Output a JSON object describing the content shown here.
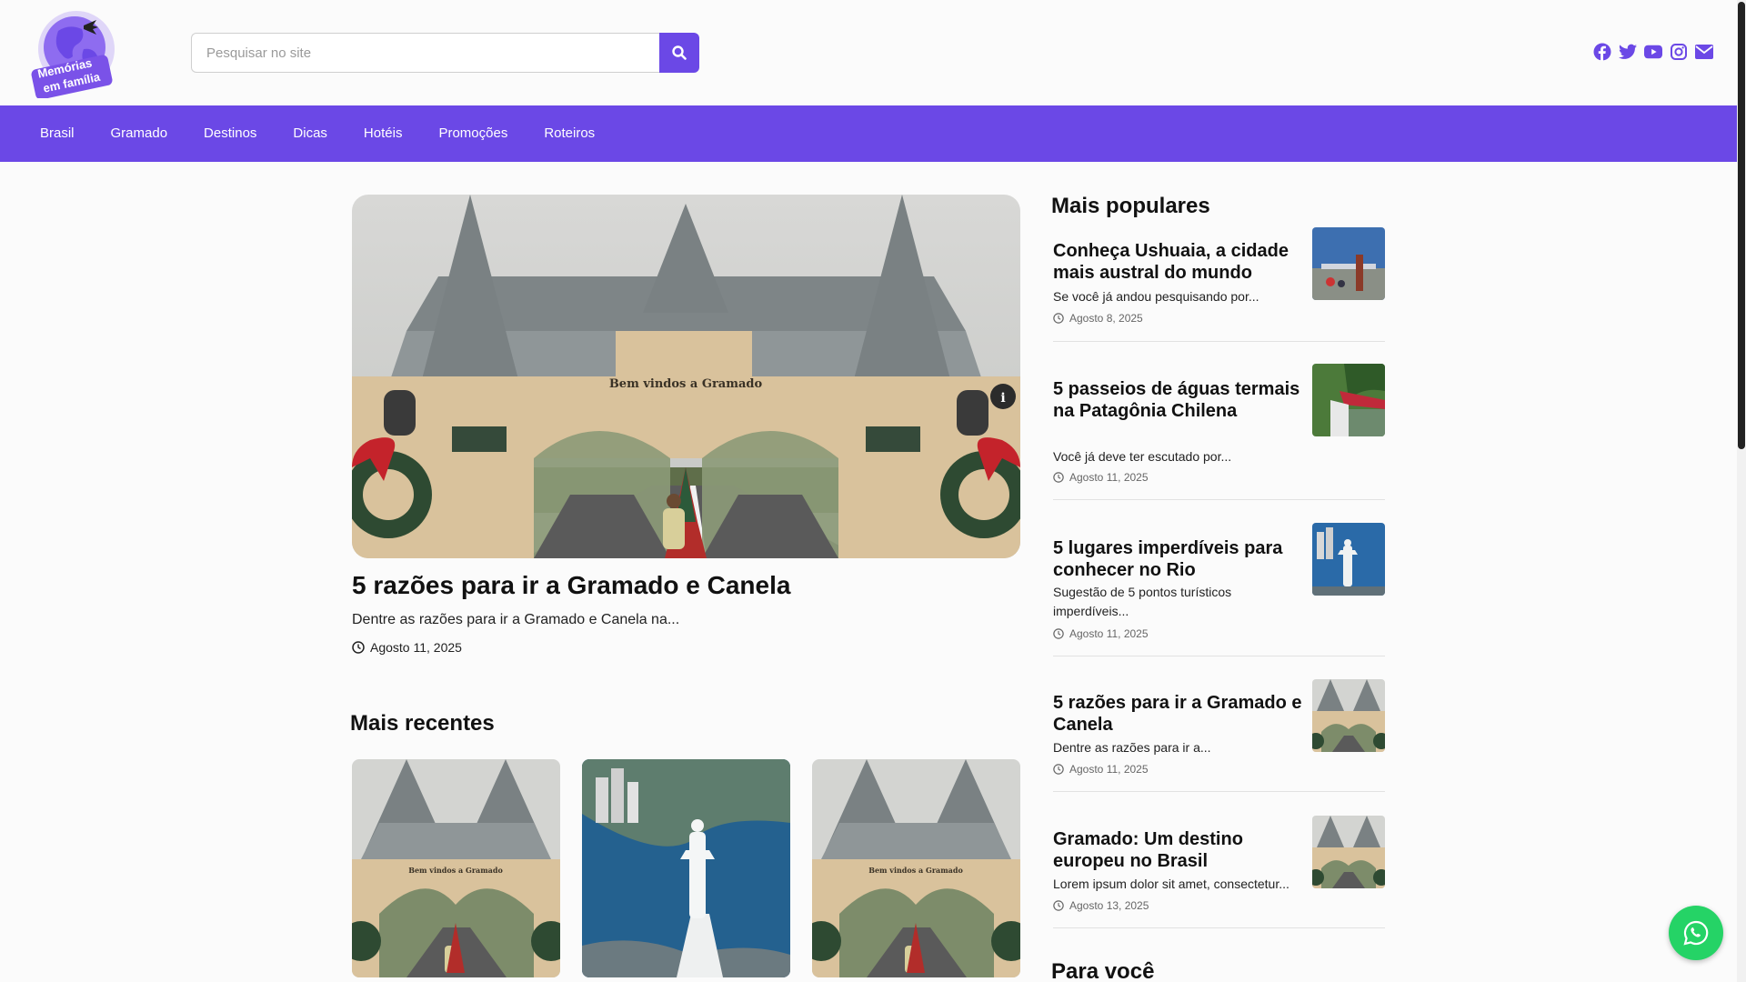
{
  "logo": {
    "text_line1": "Memórias",
    "text_line2": "em família"
  },
  "search": {
    "placeholder": "Pesquisar no site",
    "button_icon": "search-icon"
  },
  "socials": [
    "facebook-icon",
    "twitter-icon",
    "youtube-icon",
    "instagram-icon",
    "email-icon"
  ],
  "nav": {
    "items": [
      "Brasil",
      "Gramado",
      "Destinos",
      "Dicas",
      "Hotéis",
      "Promoções",
      "Roteiros"
    ]
  },
  "featured": {
    "title": "5 razões para ir a Gramado e Canela",
    "excerpt": "Dentre as razões para ir a Gramado e Canela na...",
    "date": "Agosto 11, 2025",
    "arch_sign": "Bem vindos a Gramado"
  },
  "recent": {
    "heading": "Mais recentes"
  },
  "popular": {
    "heading": "Mais populares",
    "items": [
      {
        "title": "Conheça Ushuaia, a cidade mais austral do mundo",
        "excerpt": "Se você já andou pesquisando por...",
        "date": "Agosto 8, 2025"
      },
      {
        "title": "5 passeios de águas termais na Patagônia Chilena",
        "excerpt": "Você já deve ter escutado por...",
        "date": "Agosto 11, 2025"
      },
      {
        "title": "5 lugares imperdíveis para conhecer no Rio",
        "excerpt": "Sugestão de 5 pontos turísticos imperdíveis...",
        "date": "Agosto 11, 2025"
      },
      {
        "title": "5 razões para ir a Gramado e Canela",
        "excerpt": "Dentre as razões para ir a...",
        "date": "Agosto 11, 2025"
      },
      {
        "title": "Gramado: Um destino europeu no Brasil",
        "excerpt": "Lorem ipsum dolor sit amet, consectetur...",
        "date": "Agosto 13, 2025"
      }
    ]
  },
  "for_you": {
    "heading": "Para você"
  },
  "colors": {
    "brand": "#6b48e6",
    "whatsapp": "#25d366"
  }
}
